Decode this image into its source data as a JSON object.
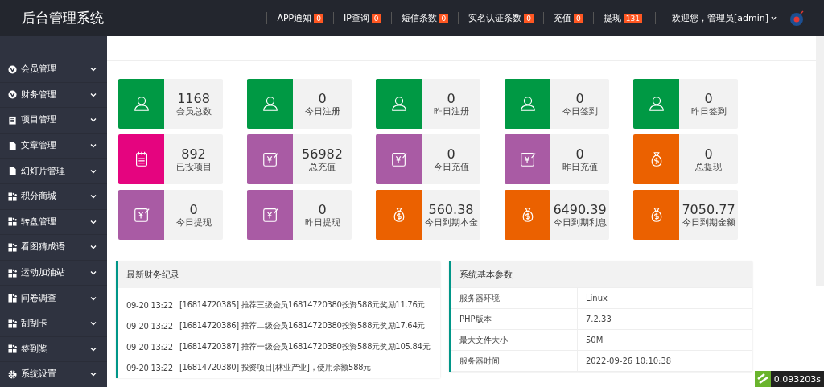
{
  "header": {
    "title": "后台管理系统",
    "notices": [
      {
        "label": "APP通知",
        "count": "0"
      },
      {
        "label": "IP查询",
        "count": "0"
      },
      {
        "label": "短信条数",
        "count": "0"
      },
      {
        "label": "实名认证条数",
        "count": "0"
      },
      {
        "label": "充值",
        "count": "0"
      },
      {
        "label": "提现",
        "count": "131"
      }
    ],
    "user": "欢迎您，管理员[admin]"
  },
  "sidebar": {
    "items": [
      {
        "label": "会员管理",
        "kind": "badge"
      },
      {
        "label": "财务管理",
        "kind": "badge"
      },
      {
        "label": "项目管理",
        "kind": "clipboard"
      },
      {
        "label": "文章管理",
        "kind": "file"
      },
      {
        "label": "幻灯片管理",
        "kind": "file"
      },
      {
        "label": "积分商城",
        "kind": "grid"
      },
      {
        "label": "转盘管理",
        "kind": "grid"
      },
      {
        "label": "看图猜成语",
        "kind": "grid"
      },
      {
        "label": "运动加油站",
        "kind": "grid"
      },
      {
        "label": "问卷调查",
        "kind": "grid"
      },
      {
        "label": "刮刮卡",
        "kind": "grid"
      },
      {
        "label": "签到奖",
        "kind": "grid"
      },
      {
        "label": "系统设置",
        "kind": "gear"
      }
    ]
  },
  "stats": [
    {
      "value": "1168",
      "label": "会员总数",
      "kind": "user",
      "color": "#009944"
    },
    {
      "value": "0",
      "label": "今日注册",
      "kind": "user",
      "color": "#009944"
    },
    {
      "value": "0",
      "label": "昨日注册",
      "kind": "user",
      "color": "#009944"
    },
    {
      "value": "0",
      "label": "今日签到",
      "kind": "user",
      "color": "#009944"
    },
    {
      "value": "0",
      "label": "昨日签到",
      "kind": "user",
      "color": "#009944"
    },
    {
      "value": "892",
      "label": "已投项目",
      "kind": "clipboard",
      "color": "#e5047f"
    },
    {
      "value": "56982",
      "label": "总充值",
      "kind": "yuan",
      "color": "#a95ba4"
    },
    {
      "value": "0",
      "label": "今日充值",
      "kind": "yuan",
      "color": "#a95ba4"
    },
    {
      "value": "0",
      "label": "昨日充值",
      "kind": "yuan",
      "color": "#a95ba4"
    },
    {
      "value": "0",
      "label": "总提现",
      "kind": "moneybag",
      "color": "#eb6100"
    },
    {
      "value": "0",
      "label": "今日提现",
      "kind": "yuan",
      "color": "#a95ba4"
    },
    {
      "value": "0",
      "label": "昨日提现",
      "kind": "yuan",
      "color": "#a95ba4"
    },
    {
      "value": "560.38",
      "label": "今日到期本金",
      "kind": "moneybag",
      "color": "#eb6100"
    },
    {
      "value": "6490.39",
      "label": "今日到期利息",
      "kind": "moneybag",
      "color": "#eb6100"
    },
    {
      "value": "7050.77",
      "label": "今日到期金额",
      "kind": "moneybag",
      "color": "#eb6100"
    }
  ],
  "finance_panel": {
    "title": "最新财务纪录",
    "rows": [
      {
        "time": "09-20 13:22",
        "text": "[16814720385] 推荐三级会员16814720380投资588元奖励11.76元"
      },
      {
        "time": "09-20 13:22",
        "text": "[16814720386] 推荐二级会员16814720380投资588元奖励17.64元"
      },
      {
        "time": "09-20 13:22",
        "text": "[16814720387] 推荐一级会员16814720380投资588元奖励105.84元"
      },
      {
        "time": "09-20 13:22",
        "text": "[16814720380] 投资项目[林业产业]，使用余额588元"
      }
    ]
  },
  "system_panel": {
    "title": "系统基本参数",
    "rows": [
      {
        "name": "服务器环境",
        "value": "Linux"
      },
      {
        "name": "PHP版本",
        "value": "7.2.33"
      },
      {
        "name": "最大文件大小",
        "value": "50M"
      },
      {
        "name": "服务器时间",
        "value": "2022-09-26 10:10:38"
      }
    ]
  },
  "timer": "0.093203s"
}
